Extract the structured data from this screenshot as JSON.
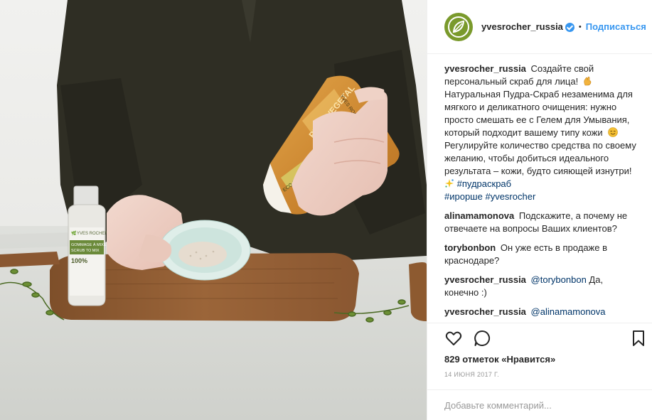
{
  "post": {
    "account": "yvesrocher_russia",
    "verified": true,
    "separator": "•",
    "follow_label": "Подписаться",
    "caption": {
      "user": "yvesrocher_russia",
      "text_1": "Создайте свой персональный скраб для лица! ",
      "emoji_1": "hand-icon",
      "text_2": "\nНатуральная Пудра-Скраб незаменима для мягкого и деликатного очищения: нужно просто смешать ее с Гелем для Умывания, который подходит вашему типу кожи ",
      "emoji_2": "smile-icon",
      "text_3": "\nРегулируйте количество средства по своему желанию, чтобы добиться идеального результата – кожи, будто сияющей изнутри! ",
      "emoji_3": "sparkle-icon",
      "hashtags_line1": "#пудраскраб",
      "hashtags_line2_a": "#ирорше",
      "hashtags_line2_b": "#yvesrocher"
    },
    "comments": [
      {
        "user": "alinamamonova",
        "text": "Подскажите, а почему не отвечаете на вопросы Ваших клиентов?"
      },
      {
        "user": "torybonbon",
        "text": "Он уже есть в продаже в краснодаре?"
      },
      {
        "user": "yvesrocher_russia",
        "mention": "@torybonbon",
        "text": " Да, конечно :)"
      },
      {
        "user": "yvesrocher_russia",
        "mention": "@alinamamonova",
        "text": ""
      }
    ],
    "likes_text": "829 отметок «Нравится»",
    "date": "14 ИЮНЯ 2017 Г.",
    "add_comment_placeholder": "Добавьте комментарий...",
    "icons": {
      "like": "heart-icon",
      "comment": "comment-icon",
      "save": "bookmark-icon"
    }
  },
  "photo": {
    "bottle_brand": "YVES ROCHER",
    "bottle_line1": "GOMMAGE À MIXER",
    "bottle_line2": "SCRUB TO MIX",
    "bottle_percent": "100%",
    "tube_brand": "YVES ROCHER",
    "tube_line": "PURE VEGETAL",
    "tube_badge": "ECO-FRIENDLY TUBE"
  },
  "colors": {
    "accent_blue": "#3897f0",
    "hashtag": "#003569",
    "brand_green": "#7a9a2c"
  }
}
